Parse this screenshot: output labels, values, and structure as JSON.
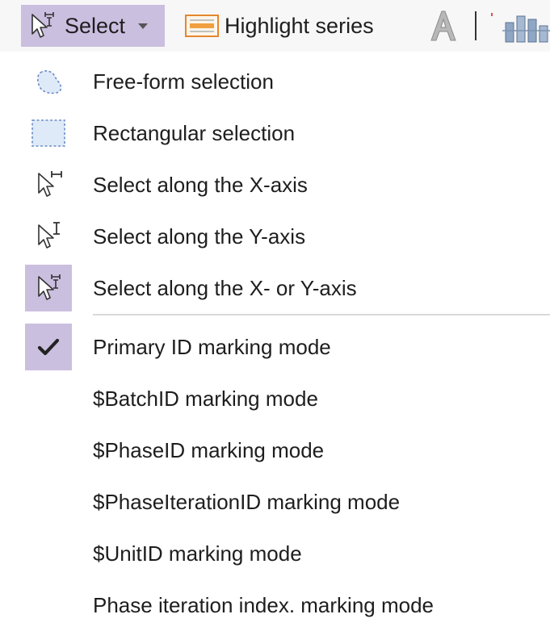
{
  "toolbar": {
    "select_label": "Select",
    "highlight_label": "Highlight series",
    "accent_color": "#cbbfe0"
  },
  "menu": {
    "selection_items": [
      {
        "label": "Free-form selection",
        "icon": "freeform-selection-icon"
      },
      {
        "label": "Rectangular selection",
        "icon": "rectangular-selection-icon"
      },
      {
        "label": "Select along the X-axis",
        "icon": "select-x-axis-icon"
      },
      {
        "label": "Select along the Y-axis",
        "icon": "select-y-axis-icon"
      },
      {
        "label": "Select along the X- or Y-axis",
        "icon": "select-xy-axis-icon",
        "selected": true
      }
    ],
    "marking_items": [
      {
        "label": "Primary ID marking mode",
        "checked": true
      },
      {
        "label": "$BatchID marking mode"
      },
      {
        "label": "$PhaseID marking mode"
      },
      {
        "label": "$PhaseIterationID marking mode"
      },
      {
        "label": "$UnitID marking mode"
      },
      {
        "label": "Phase iteration index. marking mode"
      }
    ]
  }
}
